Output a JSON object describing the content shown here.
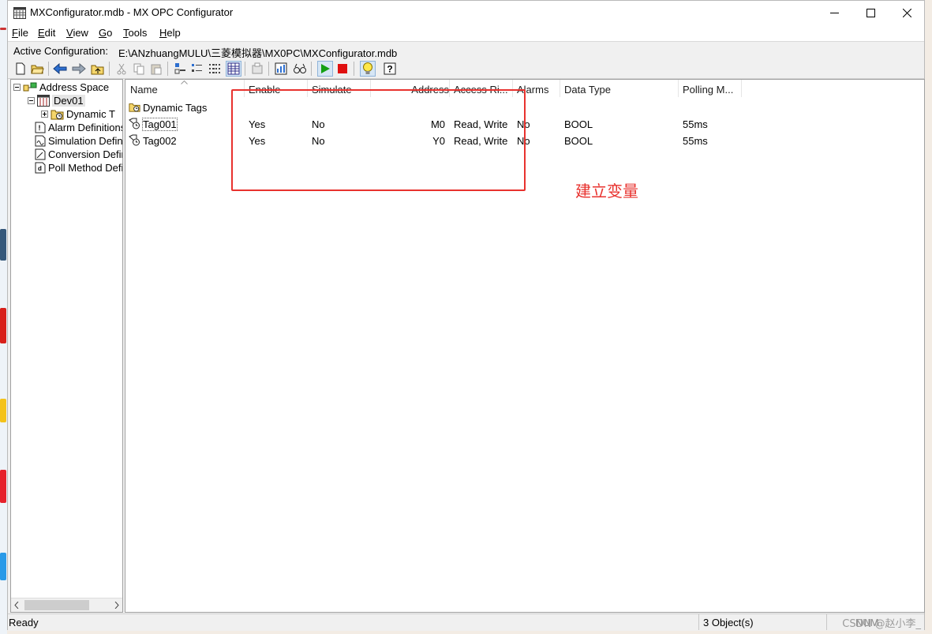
{
  "window": {
    "title": "MXConfigurator.mdb - MX OPC Configurator",
    "app_icon": "grid-app-icon",
    "controls": [
      "minimize-icon",
      "maximize-icon",
      "close-icon"
    ]
  },
  "menu": {
    "items": [
      {
        "first": "F",
        "rest": "ile"
      },
      {
        "first": "E",
        "rest": "dit"
      },
      {
        "first": "V",
        "rest": "iew"
      },
      {
        "first": "G",
        "rest": "o"
      },
      {
        "first": "T",
        "rest": "ools"
      },
      {
        "first": "H",
        "rest": "elp"
      }
    ]
  },
  "config": {
    "label": "Active Configuration:",
    "path": "E:\\ANzhuangMULU\\三菱模拟器\\MX0PC\\MXConfigurator.mdb"
  },
  "toolbar": {
    "buttons": [
      "new-icon",
      "open-icon",
      "back-icon",
      "forward-icon",
      "up-folder-icon",
      "cut-icon",
      "copy-icon",
      "paste-icon",
      "large-icons-icon",
      "small-icons-icon",
      "list-icon",
      "details-icon",
      "properties-icon",
      "chart-icon",
      "monitor-icon",
      "run-icon",
      "stop-icon",
      "bulb-icon",
      "help-icon"
    ]
  },
  "tree": {
    "items": [
      {
        "label": "Address Space",
        "icon": "address-space-icon",
        "expander": "−"
      },
      {
        "label": "Dev01",
        "icon": "device-icon",
        "expander": "−"
      },
      {
        "label": "Dynamic T",
        "icon": "tag-folder-icon",
        "expander": "+"
      },
      {
        "label": "Alarm Definitions",
        "icon": "alarm-icon"
      },
      {
        "label": "Simulation Defini",
        "icon": "simulation-icon"
      },
      {
        "label": "Conversion Defin",
        "icon": "conversion-icon"
      },
      {
        "label": "Poll Method Defi",
        "icon": "poll-icon"
      }
    ]
  },
  "list": {
    "columns": [
      "Name",
      "Enable",
      "Simulate",
      "Address",
      "Access Ri...",
      "Alarms",
      "Data Type",
      "Polling M..."
    ],
    "folder_row": {
      "name": "Dynamic Tags",
      "icon": "tag-folder-icon"
    },
    "rows": [
      {
        "name": "Tag001",
        "enable": "Yes",
        "simulate": "No",
        "address": "M0",
        "access": "Read, Write",
        "alarms": "No",
        "data_type": "BOOL",
        "polling": "55ms"
      },
      {
        "name": "Tag002",
        "enable": "Yes",
        "simulate": "No",
        "address": "Y0",
        "access": "Read, Write",
        "alarms": "No",
        "data_type": "BOOL",
        "polling": "55ms"
      }
    ]
  },
  "annotation": {
    "text": "建立变量",
    "color": "#e8322e"
  },
  "status": {
    "ready": "Ready",
    "objects": "3 Object(s)",
    "num": "NUM"
  },
  "watermark": "CSDN @赵小李_"
}
